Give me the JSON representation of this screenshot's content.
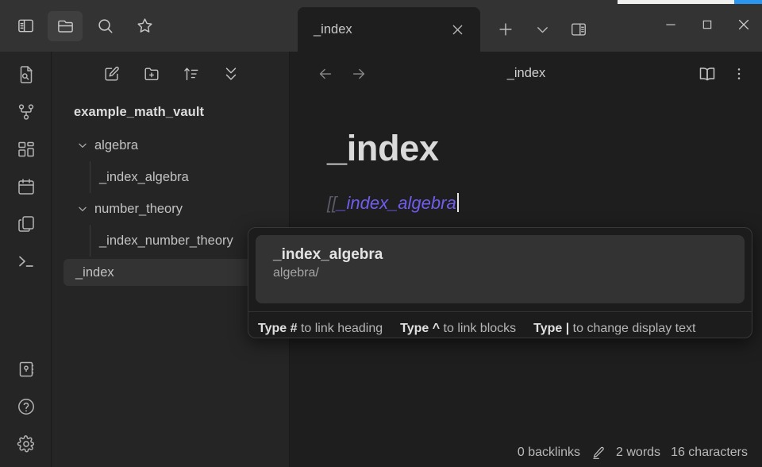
{
  "colors": {
    "accent_blue": "#2b96f1",
    "link_purple": "#705dee",
    "header_bg": "#333333",
    "sidebar_bg": "#252525",
    "editor_bg": "#1e1e1e",
    "popup_bg": "#1c1c1c",
    "selected_item_bg": "#333333"
  },
  "ribbon": {
    "top_icon": "sidebar-toggle-icon",
    "items": [
      {
        "name": "file-search-icon",
        "label": "Search in file"
      },
      {
        "name": "graph-view-icon",
        "label": "Graph view"
      },
      {
        "name": "canvas-icon",
        "label": "Canvas"
      },
      {
        "name": "daily-note-icon",
        "label": "Daily note"
      },
      {
        "name": "templates-icon",
        "label": "Templates"
      },
      {
        "name": "terminal-icon",
        "label": "Terminal"
      }
    ],
    "bottom_items": [
      {
        "name": "vault-switcher-icon",
        "label": "Open another vault"
      },
      {
        "name": "help-icon",
        "label": "Help"
      },
      {
        "name": "settings-icon",
        "label": "Settings"
      }
    ]
  },
  "header": {
    "buttons": [
      {
        "name": "toggle-left-sidebar-icon",
        "label": "Toggle left sidebar",
        "active": false
      },
      {
        "name": "folder-icon",
        "label": "Files",
        "active": true
      },
      {
        "name": "search-icon",
        "label": "Search",
        "active": false
      },
      {
        "name": "star-icon",
        "label": "Bookmarks",
        "active": false
      }
    ]
  },
  "tabs": {
    "items": [
      {
        "title": "_index",
        "close_label": "Close tab",
        "active": true
      }
    ],
    "actions": [
      {
        "name": "new-tab-icon",
        "label": "New tab"
      },
      {
        "name": "chevron-down-icon",
        "label": "Tab list"
      },
      {
        "name": "toggle-right-sidebar-icon",
        "label": "Toggle right sidebar"
      }
    ]
  },
  "window_controls": [
    {
      "name": "minimize-button",
      "label": "Minimize"
    },
    {
      "name": "maximize-button",
      "label": "Maximize"
    },
    {
      "name": "close-button",
      "label": "Close"
    }
  ],
  "sidebar": {
    "toolbar": [
      {
        "name": "new-note-icon",
        "label": "New note"
      },
      {
        "name": "new-folder-icon",
        "label": "New folder"
      },
      {
        "name": "sort-icon",
        "label": "Change sort order"
      },
      {
        "name": "collapse-all-icon",
        "label": "Collapse all"
      }
    ],
    "vault_name": "example_math_vault",
    "tree": [
      {
        "label": "algebra",
        "type": "folder",
        "expanded": true,
        "depth": 0,
        "selected": false
      },
      {
        "label": "_index_algebra",
        "type": "file",
        "depth": 1,
        "selected": false
      },
      {
        "label": "number_theory",
        "type": "folder",
        "expanded": true,
        "depth": 0,
        "selected": false
      },
      {
        "label": "_index_number_theory",
        "type": "file",
        "depth": 1,
        "selected": false
      },
      {
        "label": "_index",
        "type": "file",
        "depth": 0,
        "selected": true
      }
    ]
  },
  "editor": {
    "nav": [
      {
        "name": "back-arrow-icon",
        "label": "Navigate back"
      },
      {
        "name": "forward-arrow-icon",
        "label": "Navigate forward"
      }
    ],
    "title": "_index",
    "right_actions": [
      {
        "name": "reading-view-icon",
        "label": "Reading view"
      },
      {
        "name": "more-options-icon",
        "label": "More options"
      }
    ],
    "document": {
      "heading": "_index",
      "paragraph_prefix": "[[",
      "paragraph_link": "_index_algebra"
    }
  },
  "autocomplete": {
    "item": {
      "title": "_index_algebra",
      "subtitle": "algebra/"
    },
    "hints": [
      {
        "key": "Type #",
        "text": "to link heading"
      },
      {
        "key": "Type ^",
        "text": "to link blocks"
      },
      {
        "key": "Type |",
        "text": "to change display text"
      }
    ]
  },
  "status_bar": {
    "backlinks": "0 backlinks",
    "edit_icon": "pencil-icon",
    "words": "2 words",
    "characters": "16 characters"
  }
}
